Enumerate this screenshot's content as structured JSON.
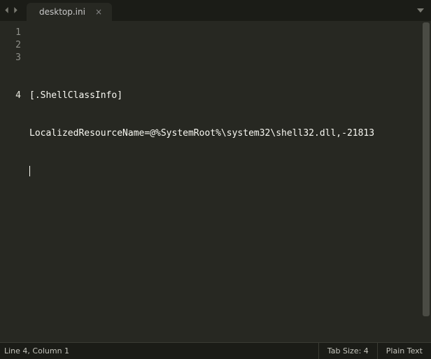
{
  "tab": {
    "title": "desktop.ini"
  },
  "gutter": {
    "l1": "1",
    "l2": "2",
    "l3": "3",
    "l4": "4"
  },
  "lines": {
    "l1": "",
    "l2": "[.ShellClassInfo]",
    "l3": "LocalizedResourceName=@%SystemRoot%\\system32\\shell32.dll,-21813",
    "l4": ""
  },
  "status": {
    "position": "Line 4, Column 1",
    "tab_size": "Tab Size: 4",
    "syntax": "Plain Text"
  }
}
